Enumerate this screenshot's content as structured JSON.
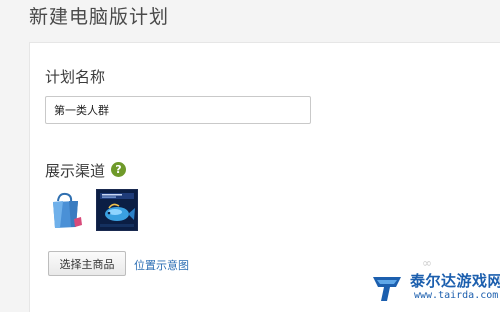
{
  "page": {
    "title": "新建电脑版计划"
  },
  "plan_name": {
    "label": "计划名称",
    "value": "第一类人群"
  },
  "channel": {
    "label": "展示渠道",
    "help_icon": "question-mark-icon",
    "help_glyph": "?",
    "help_color": "#6f9a2a",
    "products": [
      {
        "icon": "shopping-bag-product-image"
      },
      {
        "icon": "aquarium-fish-product-image"
      }
    ]
  },
  "actions": {
    "select_label": "选择主商品",
    "position_link": "位置示意图",
    "link_color": "#2d6fb4"
  },
  "watermark": {
    "name": "泰尔达游戏网",
    "url": "www.tairda.com",
    "icon": "tairda-logo"
  }
}
